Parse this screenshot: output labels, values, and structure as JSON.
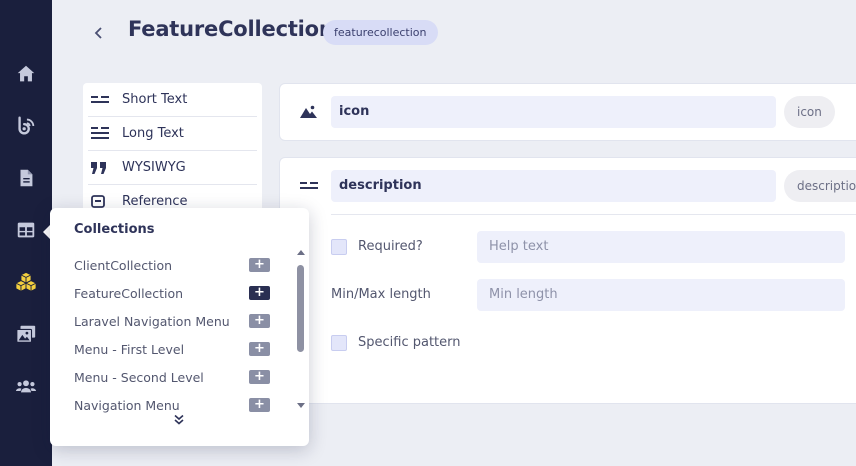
{
  "page": {
    "title": "FeatureCollection",
    "slug": "featurecollection",
    "back_icon": "chevron-left-icon"
  },
  "rail": {
    "items": [
      {
        "name": "home",
        "icon": "home-icon"
      },
      {
        "name": "blog",
        "icon": "blog-icon"
      },
      {
        "name": "pages",
        "icon": "document-icon"
      },
      {
        "name": "collections",
        "icon": "table-icon"
      },
      {
        "name": "components",
        "icon": "cubes-icon"
      },
      {
        "name": "media",
        "icon": "media-icon"
      },
      {
        "name": "users",
        "icon": "users-icon"
      }
    ]
  },
  "field_types": [
    {
      "label": "Short Text",
      "icon": "short-text-icon"
    },
    {
      "label": "Long Text",
      "icon": "long-text-icon"
    },
    {
      "label": "WYSIWYG",
      "icon": "quote-icon"
    },
    {
      "label": "Reference",
      "icon": "reference-icon"
    }
  ],
  "fields": [
    {
      "name": "icon",
      "slug": "icon",
      "icon": "image-icon"
    },
    {
      "name": "description",
      "slug": "description",
      "icon": "short-text-icon"
    }
  ],
  "field_options": {
    "required_label": "Required?",
    "help_text_placeholder": "Help text",
    "minmax_label": "Min/Max length",
    "min_length_placeholder": "Min length",
    "pattern_label": "Specific pattern"
  },
  "collections_popover": {
    "title": "Collections",
    "items": [
      {
        "label": "ClientCollection",
        "active": false
      },
      {
        "label": "FeatureCollection",
        "active": true
      },
      {
        "label": "Laravel Navigation Menu",
        "active": false
      },
      {
        "label": "Menu - First Level",
        "active": false
      },
      {
        "label": "Menu - Second Level",
        "active": false
      },
      {
        "label": "Navigation Menu",
        "active": false
      }
    ],
    "add_label": "+"
  },
  "colors": {
    "rail_bg": "#1a1f3d",
    "accent_yellow": "#f4d03f",
    "badge_bg": "#d8dcf6",
    "input_bg": "#eef0fb"
  }
}
